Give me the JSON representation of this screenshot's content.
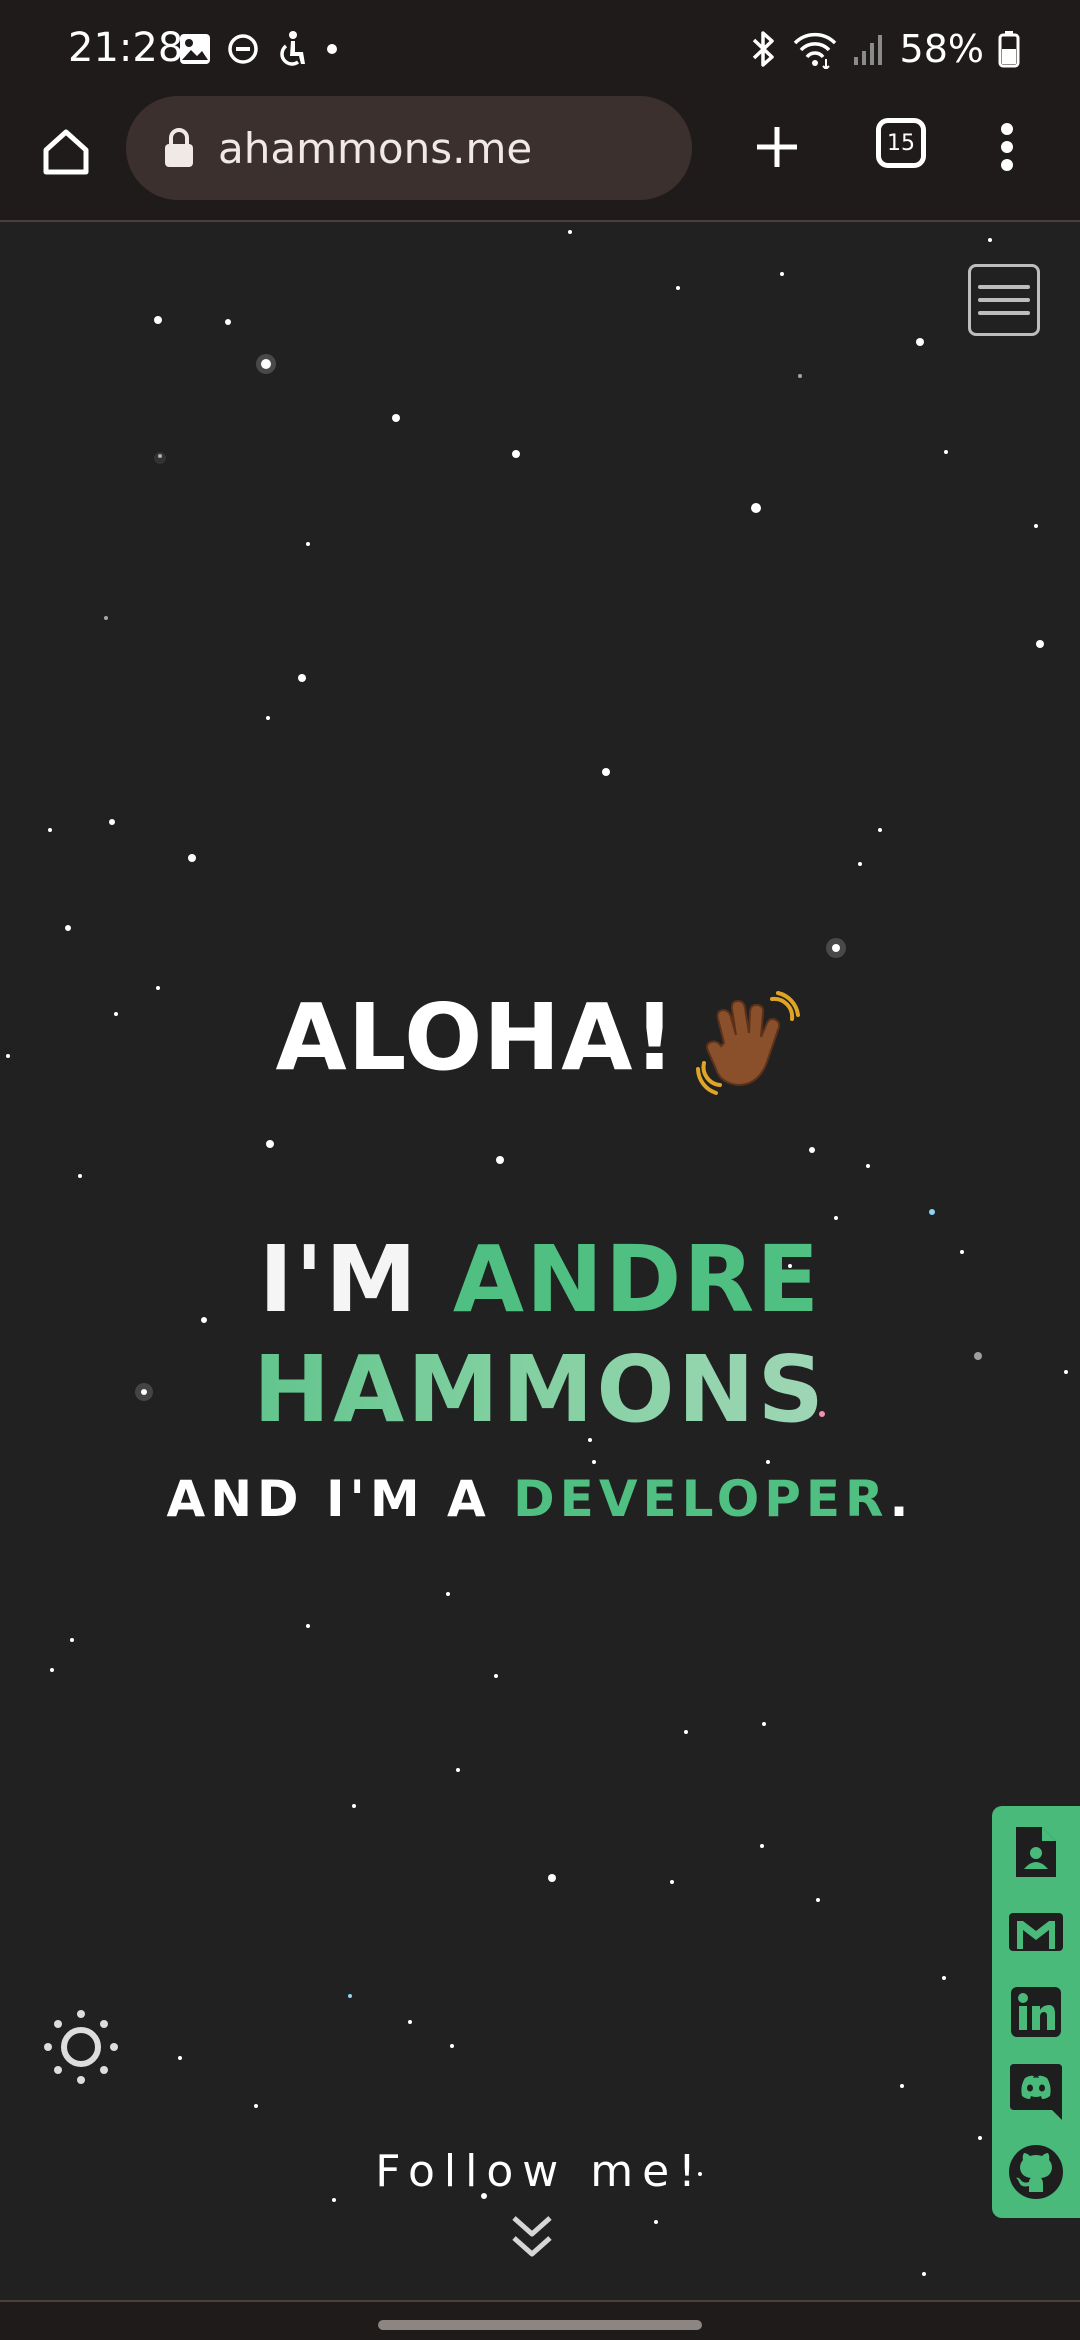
{
  "status_bar": {
    "time": "21:28",
    "battery": "58%",
    "icons_left": [
      "gallery-icon",
      "do-not-disturb-icon",
      "accessibility-icon",
      "dot-icon"
    ],
    "icons_right": [
      "bluetooth-icon",
      "wifi-icon",
      "signal-icon",
      "battery-icon"
    ]
  },
  "browser": {
    "url": "ahammons.me",
    "tab_count": "15"
  },
  "hero": {
    "greeting": "ALOHA!",
    "intro_prefix": "I'M",
    "first_name": "ANDRE",
    "last_name": "HAMMONS",
    "tagline_prefix": "AND I'M A",
    "role": "DEVELOPER",
    "tagline_suffix": "."
  },
  "social_links": [
    "resume-icon",
    "email-icon",
    "linkedin-icon",
    "discord-icon",
    "github-icon"
  ],
  "footer": {
    "follow_text": "Follow me!"
  },
  "colors": {
    "accent": "#4aba7b",
    "background": "#212121",
    "chrome": "#1f1b1a"
  }
}
